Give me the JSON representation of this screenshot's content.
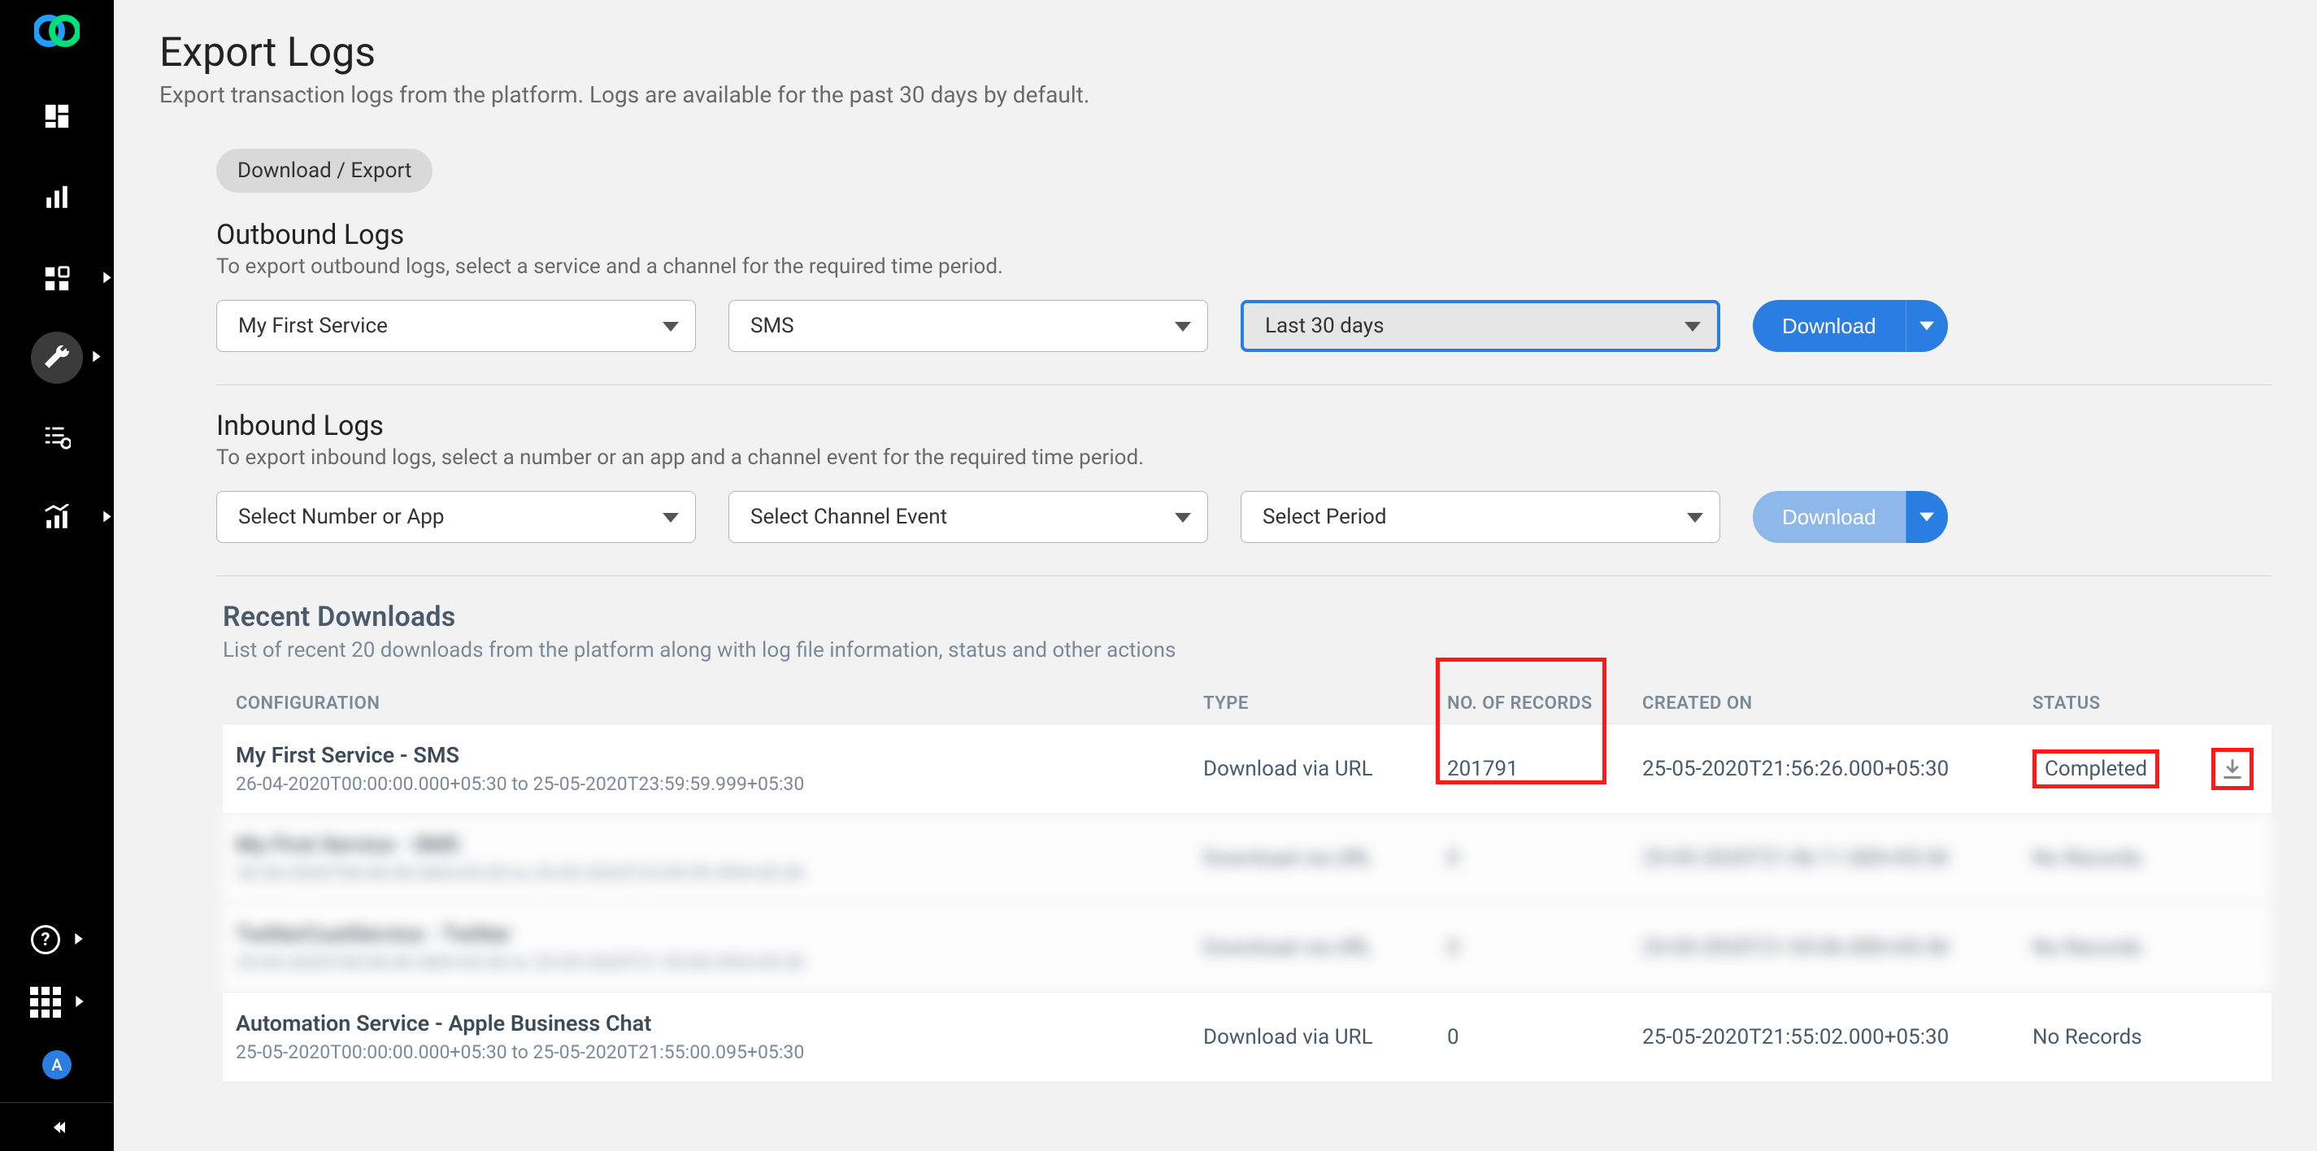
{
  "sidebar": {
    "avatar_initial": "A"
  },
  "header": {
    "title": "Export Logs",
    "subtitle": "Export transaction logs from the platform. Logs are available for the past 30 days by default."
  },
  "chip": {
    "label": "Download / Export"
  },
  "outbound": {
    "title": "Outbound Logs",
    "subtitle": "To export outbound logs, select a service and a channel for the required time period.",
    "service": "My First Service",
    "channel": "SMS",
    "period": "Last 30 days",
    "button": "Download"
  },
  "inbound": {
    "title": "Inbound Logs",
    "subtitle": "To export inbound logs, select a number or an app and a channel event for the required time period.",
    "number_or_app": "Select Number or App",
    "channel_event": "Select Channel Event",
    "period": "Select Period",
    "button": "Download"
  },
  "recent": {
    "title": "Recent Downloads",
    "subtitle": "List of recent 20 downloads from the platform along with log file information, status and other actions",
    "columns": {
      "configuration": "CONFIGURATION",
      "type": "TYPE",
      "records": "NO. OF RECORDS",
      "created": "CREATED ON",
      "status": "STATUS"
    },
    "rows": [
      {
        "name": "My First Service - SMS",
        "range": "26-04-2020T00:00:00.000+05:30 to 25-05-2020T23:59:59.999+05:30",
        "type": "Download via URL",
        "records": "201791",
        "created": "25-05-2020T21:56:26.000+05:30",
        "status": "Completed"
      },
      {
        "name": "My First Service - SMS",
        "range": "26-04-2020T00:00:00.000+05:30 to 25-05-2020T23:59:59.999+05:30",
        "type": "Download via URL",
        "records": "0",
        "created": "25-05-2020T21:56:11.000+05:30",
        "status": "No Records"
      },
      {
        "name": "TwitterCustService - Twitter",
        "range": "25-05-2020T00:00:00.000+05:30 to 25-05-2020T21:55:00.095+05:30",
        "type": "Download via URL",
        "records": "0",
        "created": "25-05-2020T21:55:06.000+05:30",
        "status": "No Records"
      },
      {
        "name": "Automation Service - Apple Business Chat",
        "range": "25-05-2020T00:00:00.000+05:30 to 25-05-2020T21:55:00.095+05:30",
        "type": "Download via URL",
        "records": "0",
        "created": "25-05-2020T21:55:02.000+05:30",
        "status": "No Records"
      }
    ]
  }
}
